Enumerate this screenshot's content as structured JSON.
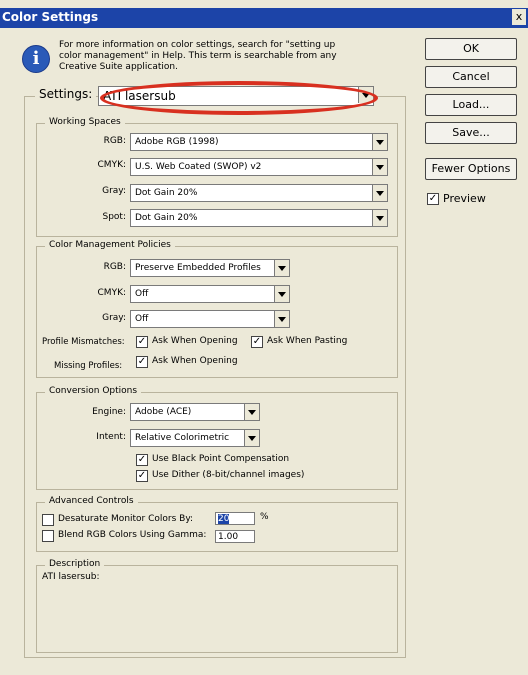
{
  "window": {
    "title": "Color Settings",
    "close_glyph": "x"
  },
  "info": {
    "icon": "info-icon",
    "line1": "For more information on color settings, search for \"setting up",
    "line2": "color management\" in Help. This term is searchable from any",
    "line3": "Creative Suite application."
  },
  "buttons": {
    "ok": "OK",
    "cancel": "Cancel",
    "load": "Load...",
    "save": "Save...",
    "fewer": "Fewer Options"
  },
  "preview": {
    "label": "Preview",
    "checked": "✓"
  },
  "settings": {
    "label": "Settings:",
    "value": "ATI lasersub"
  },
  "working_spaces": {
    "legend": "Working Spaces",
    "rgb_label": "RGB:",
    "rgb_value": "Adobe RGB (1998)",
    "cmyk_label": "CMYK:",
    "cmyk_value": "U.S. Web Coated (SWOP) v2",
    "gray_label": "Gray:",
    "gray_value": "Dot Gain 20%",
    "spot_label": "Spot:",
    "spot_value": "Dot Gain 20%"
  },
  "policies": {
    "legend": "Color Management Policies",
    "rgb_label": "RGB:",
    "rgb_value": "Preserve Embedded Profiles",
    "cmyk_label": "CMYK:",
    "cmyk_value": "Off",
    "gray_label": "Gray:",
    "gray_value": "Off",
    "mismatch_label": "Profile Mismatches:",
    "ask_opening": "Ask When Opening",
    "ask_pasting": "Ask When Pasting",
    "missing_label": "Missing Profiles:",
    "missing_ask_opening": "Ask When Opening"
  },
  "conversion": {
    "legend": "Conversion Options",
    "engine_label": "Engine:",
    "engine_value": "Adobe (ACE)",
    "intent_label": "Intent:",
    "intent_value": "Relative Colorimetric",
    "bpc": "Use Black Point Compensation",
    "dither": "Use Dither (8-bit/channel images)"
  },
  "advanced": {
    "legend": "Advanced Controls",
    "desaturate": "Desaturate Monitor Colors By:",
    "desaturate_value": "20",
    "percent": "%",
    "blend": "Blend RGB Colors Using Gamma:",
    "blend_value": "1.00"
  },
  "description": {
    "legend": "Description",
    "text": "ATI lasersub:"
  },
  "colors": {
    "titlebar": "#1c44a8",
    "highlight_ellipse": "#d83020"
  }
}
